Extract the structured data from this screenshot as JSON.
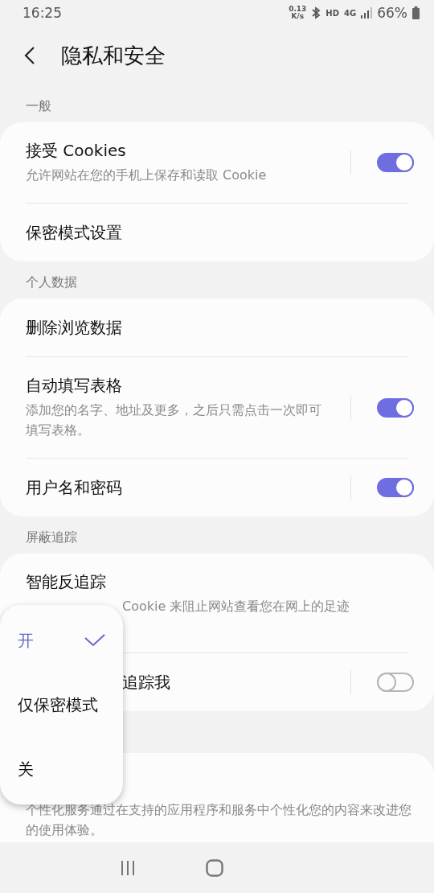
{
  "status_bar": {
    "time": "16:25",
    "speed_value": "0.13",
    "speed_unit": "K/s",
    "hd": "HD",
    "network": "4G",
    "battery": "66%"
  },
  "header": {
    "title": "隐私和安全"
  },
  "sections": [
    {
      "label": "一般",
      "items": [
        {
          "kind": "switch",
          "title": "接受 Cookies",
          "subtitle": "允许网站在您的手机上保存和读取 Cookie",
          "on": true
        },
        {
          "kind": "link",
          "title": "保密模式设置"
        }
      ]
    },
    {
      "label": "个人数据",
      "items": [
        {
          "kind": "link",
          "title": "删除浏览数据"
        },
        {
          "kind": "switch",
          "title": "自动填写表格",
          "subtitle": "添加您的名字、地址及更多，之后只需点击一次即可填写表格。",
          "on": true
        },
        {
          "kind": "switch",
          "title": "用户名和密码",
          "on": true
        }
      ]
    },
    {
      "label": "屏蔽追踪",
      "items": [
        {
          "kind": "link",
          "title": "智能反追踪",
          "subtitle": "Cookie 来阻止网站查看您在网上的足迹",
          "subtitle_covered": true
        },
        {
          "kind": "switch",
          "title": "追踪我",
          "on": false,
          "title_covered": true
        }
      ]
    },
    {
      "items": [
        {
          "kind": "link",
          "subtitle": "个性化服务通过在支持的应用程序和服务中个性化您的内容来改进您的使用体验。"
        }
      ]
    }
  ],
  "popup": {
    "options": [
      {
        "label": "开",
        "selected": true
      },
      {
        "label": "仅保密模式",
        "selected": false
      },
      {
        "label": "关",
        "selected": false
      }
    ]
  }
}
